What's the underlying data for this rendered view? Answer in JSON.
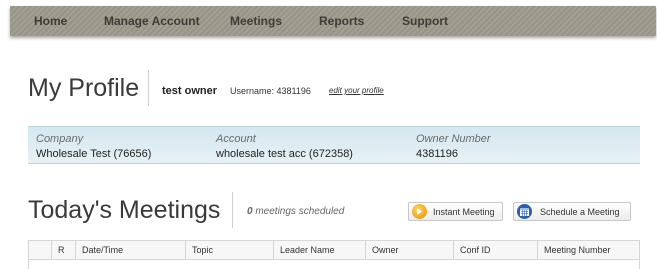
{
  "nav": {
    "items": [
      {
        "label": "Home"
      },
      {
        "label": "Manage Account"
      },
      {
        "label": "Meetings"
      },
      {
        "label": "Reports"
      },
      {
        "label": "Support"
      }
    ]
  },
  "profile": {
    "title": "My Profile",
    "owner_name": "test owner",
    "username": "Username: 4381196",
    "edit_link": "edit your profile"
  },
  "account": {
    "company_label": "Company",
    "company_value": "Wholesale Test (76656)",
    "account_label": "Account",
    "account_value": "wholesale test acc (672358)",
    "owner_number_label": "Owner Number",
    "owner_number_value": "4381196"
  },
  "meetings": {
    "title": "Today's Meetings",
    "count": "0",
    "count_suffix": "meetings scheduled",
    "instant_button": "Instant Meeting",
    "schedule_button": "Schedule a Meeting",
    "instant_icon": "arrow-circle-icon",
    "schedule_icon": "calendar-icon"
  },
  "table": {
    "columns": [
      "",
      "R",
      "Date/Time",
      "Topic",
      "Leader Name",
      "Owner",
      "Conf ID",
      "Meeting Number"
    ]
  },
  "colors": {
    "nav_bg": "#9b9a8c",
    "panel_bg": "#dbebf2",
    "instant_icon": "#f0a000",
    "schedule_icon": "#2d5fa8"
  }
}
